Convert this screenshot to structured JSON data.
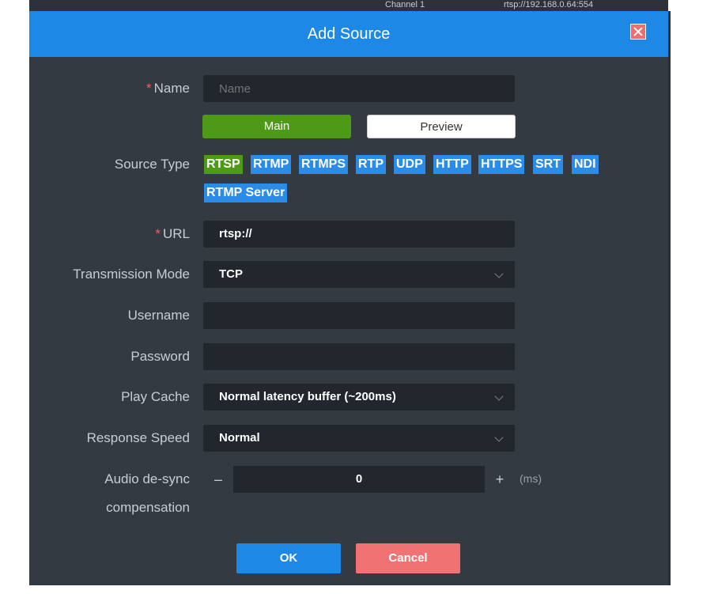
{
  "background": {
    "snippet_1": "Channel 1",
    "snippet_2": "rtsp://192.168.0.64:554"
  },
  "dialog": {
    "title": "Add Source"
  },
  "form": {
    "name": {
      "label": "Name",
      "placeholder": "Name",
      "required_mark": "*"
    },
    "stream_tabs": [
      "Main",
      "Preview"
    ],
    "source_type": {
      "label": "Source Type",
      "options": [
        "RTSP",
        "RTMP",
        "RTMPS",
        "RTP",
        "UDP",
        "HTTP",
        "HTTPS",
        "SRT",
        "NDI",
        "RTMP Server"
      ],
      "selected": "RTSP"
    },
    "url": {
      "label": "URL",
      "value": "rtsp://",
      "required_mark": "*"
    },
    "transmission_mode": {
      "label": "Transmission Mode",
      "value": "TCP"
    },
    "username": {
      "label": "Username",
      "value": ""
    },
    "password": {
      "label": "Password",
      "value": ""
    },
    "play_cache": {
      "label": "Play Cache",
      "value": "Normal latency buffer (~200ms)"
    },
    "response_speed": {
      "label": "Response Speed",
      "value": "Normal"
    },
    "audio_desync": {
      "label_line1": "Audio de-sync",
      "label_line2": "compensation",
      "value": "0",
      "minus": "–",
      "plus": "+",
      "unit": "(ms)"
    }
  },
  "buttons": {
    "ok": "OK",
    "cancel": "Cancel"
  },
  "colors": {
    "title_bar": "#1d88e5",
    "dialog_bg": "#343a42",
    "field_bg": "#22262d",
    "active_green": "#4d9a16",
    "chip_blue": "#2b8ce8",
    "cancel_red": "#f07272"
  }
}
